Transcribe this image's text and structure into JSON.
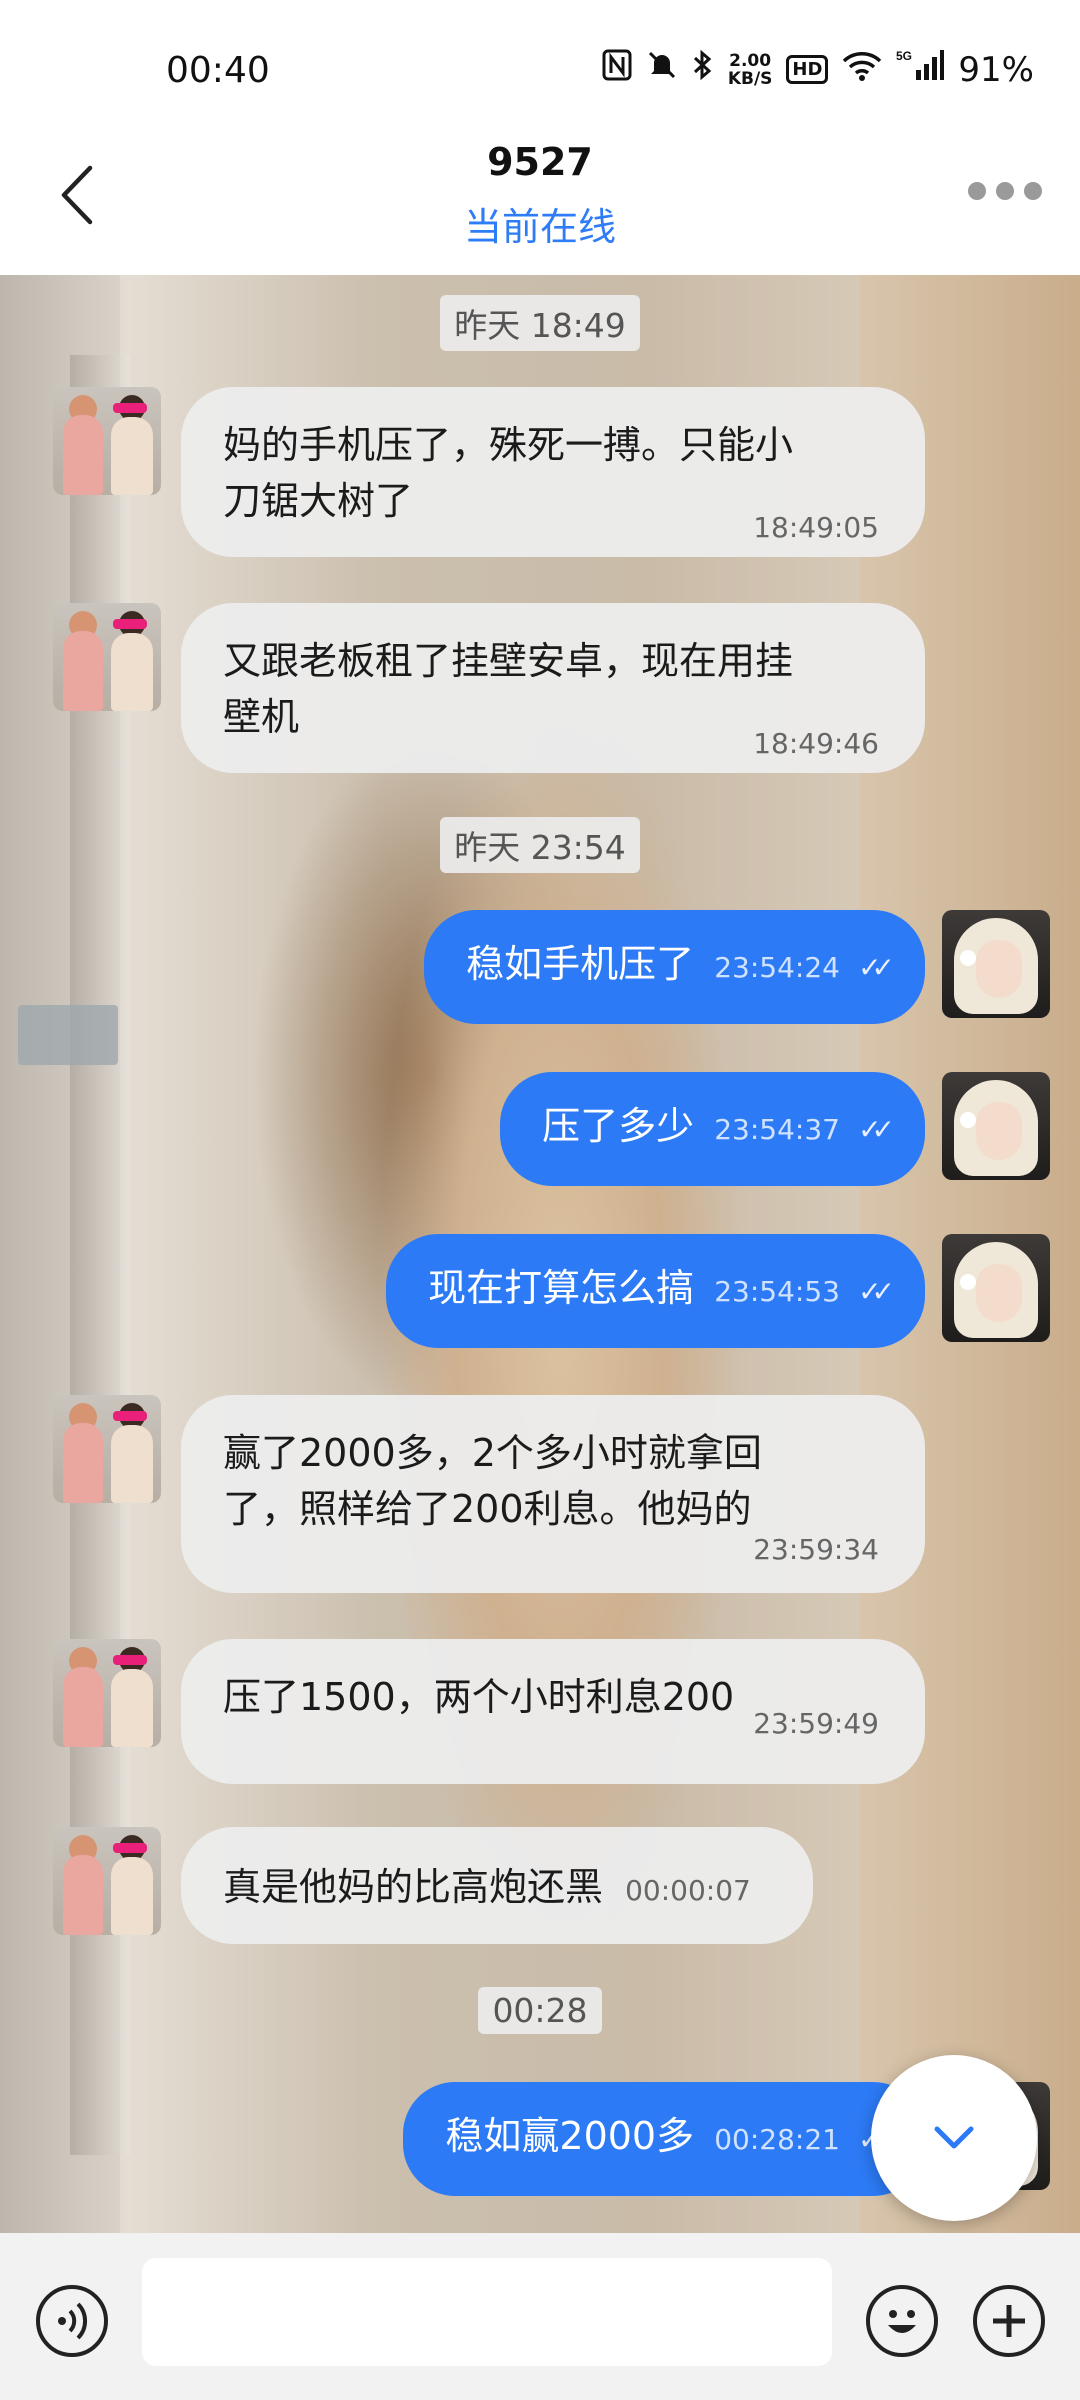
{
  "status_bar": {
    "time": "00:40",
    "speed_value": "2.00",
    "speed_unit": "KB/S",
    "hd_label": "HD",
    "network_label": "5G",
    "battery": "91%",
    "icons": [
      "nfc-icon",
      "mute-icon",
      "bluetooth-icon",
      "hd-icon",
      "wifi-icon",
      "signal-icon"
    ]
  },
  "header": {
    "title": "9527",
    "status": "当前在线"
  },
  "messages": [
    {
      "type": "timestamp",
      "text": "昨天 18:49"
    },
    {
      "type": "received",
      "lines": [
        "妈的手机压了，殊死一搏。只能小",
        "刀锯大树了"
      ],
      "time": "18:49:05"
    },
    {
      "type": "received",
      "lines": [
        "又跟老板租了挂壁安卓，现在用挂",
        "壁机"
      ],
      "time": "18:49:46"
    },
    {
      "type": "timestamp",
      "text": "昨天 23:54"
    },
    {
      "type": "sent",
      "text": "稳如手机压了",
      "time": "23:54:24",
      "read": true
    },
    {
      "type": "sent",
      "text": "压了多少",
      "time": "23:54:37",
      "read": true
    },
    {
      "type": "sent",
      "text": "现在打算怎么搞",
      "time": "23:54:53",
      "read": true
    },
    {
      "type": "received",
      "lines": [
        "赢了2000多，2个多小时就拿回",
        "了，照样给了200利息。他妈的"
      ],
      "time": "23:59:34"
    },
    {
      "type": "received",
      "lines": [
        "压了1500，两个小时利息200"
      ],
      "time": "23:59:49"
    },
    {
      "type": "received",
      "lines": [
        "真是他妈的比高炮还黑"
      ],
      "time": "00:00:07"
    },
    {
      "type": "timestamp",
      "text": "00:28"
    },
    {
      "type": "sent",
      "text": "稳如赢2000多",
      "time": "00:28:21",
      "read": true
    }
  ],
  "colors": {
    "accent": "#2c7af5",
    "online_status": "#2e7cf6",
    "received_bubble": "#ececec"
  }
}
